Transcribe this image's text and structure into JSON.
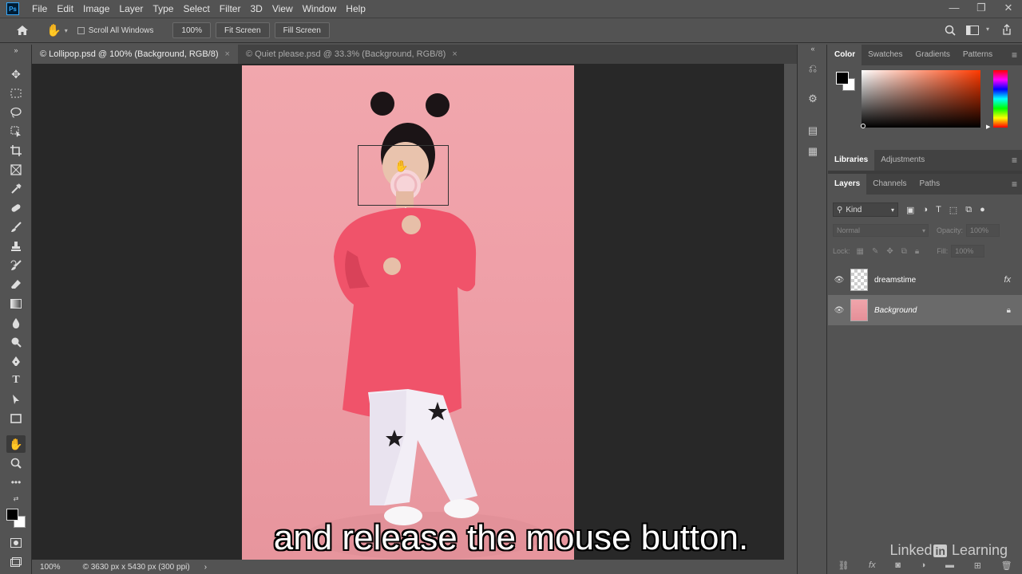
{
  "menu": [
    "File",
    "Edit",
    "Image",
    "Layer",
    "Type",
    "Select",
    "Filter",
    "3D",
    "View",
    "Window",
    "Help"
  ],
  "app_icon": "Ps",
  "window_controls": [
    "—",
    "❐",
    "✕"
  ],
  "options": {
    "scroll_all_windows": "Scroll All Windows",
    "zoom_value": "100%",
    "fit_screen": "Fit Screen",
    "fill_screen": "Fill Screen"
  },
  "tabs": [
    {
      "label": "© Lollipop.psd @ 100% (Background, RGB/8)",
      "close": "×"
    },
    {
      "label": "© Quiet please.psd @ 33.3% (Background, RGB/8)",
      "close": "×"
    }
  ],
  "status": {
    "zoom": "100%",
    "doc_info": "© 3630 px x 5430 px (300 ppi)",
    "arrow": "›"
  },
  "color_panel": {
    "tabs": [
      "Color",
      "Swatches",
      "Gradients",
      "Patterns"
    ],
    "foreground": "#000000",
    "background": "#ffffff",
    "field_hue": "#ff3a00"
  },
  "libs_panel": {
    "tabs": [
      "Libraries",
      "Adjustments"
    ]
  },
  "layers_panel": {
    "tabs": [
      "Layers",
      "Channels",
      "Paths"
    ],
    "kind": "Kind",
    "blend_mode": "Normal",
    "opacity_label": "Opacity:",
    "opacity_value": "100%",
    "lock_label": "Lock:",
    "fill_label": "Fill:",
    "fill_value": "100%",
    "layers": [
      {
        "name": "dreamstime",
        "fx": "fx"
      },
      {
        "name": "Background"
      }
    ]
  },
  "caption": "and release the mouse button.",
  "watermark": {
    "text1": "Linked",
    "in": "in",
    "text2": "Learning"
  }
}
